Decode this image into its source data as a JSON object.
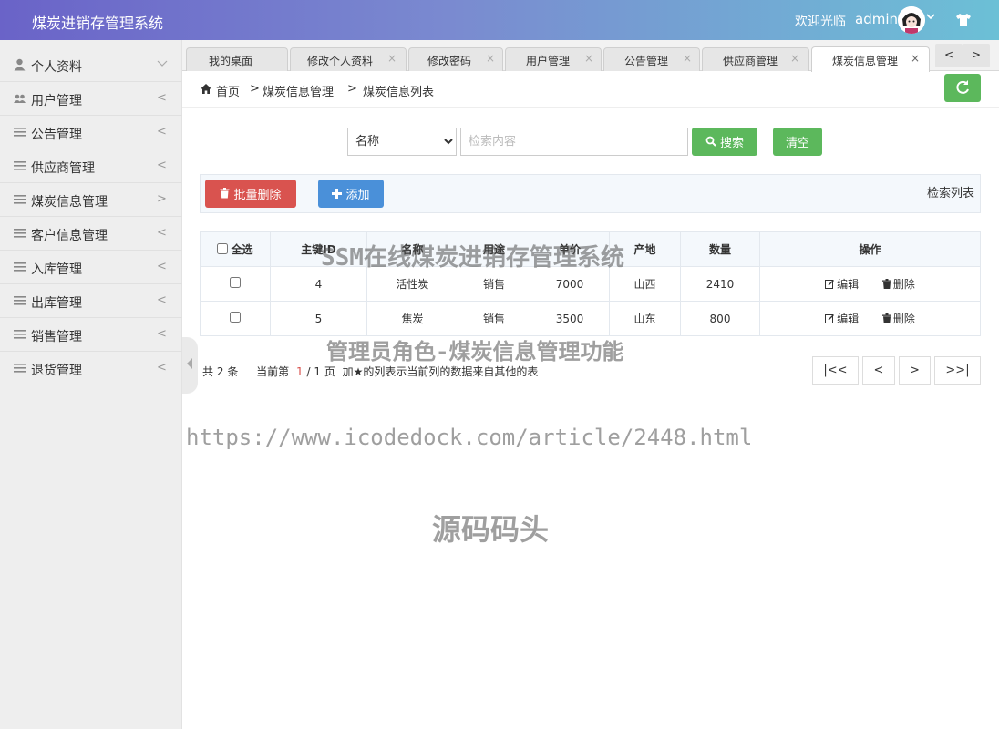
{
  "header": {
    "app_title": "煤炭进销存管理系统",
    "welcome": "欢迎光临",
    "username": "admin"
  },
  "sidebar": {
    "items": [
      {
        "label": "个人资料",
        "icon": "user-icon",
        "chevron": "﹀"
      },
      {
        "label": "用户管理",
        "icon": "users-icon",
        "chevron": "<"
      },
      {
        "label": "公告管理",
        "icon": "list-icon",
        "chevron": "<"
      },
      {
        "label": "供应商管理",
        "icon": "list-icon",
        "chevron": "<"
      },
      {
        "label": "煤炭信息管理",
        "icon": "list-icon",
        "chevron": ">"
      },
      {
        "label": "客户信息管理",
        "icon": "list-icon",
        "chevron": "<"
      },
      {
        "label": "入库管理",
        "icon": "list-icon",
        "chevron": "<"
      },
      {
        "label": "出库管理",
        "icon": "list-icon",
        "chevron": "<"
      },
      {
        "label": "销售管理",
        "icon": "list-icon",
        "chevron": "<"
      },
      {
        "label": "退货管理",
        "icon": "list-icon",
        "chevron": "<"
      }
    ]
  },
  "tabs": [
    {
      "label": "我的桌面",
      "closable": false,
      "active": false
    },
    {
      "label": "修改个人资料",
      "closable": true,
      "active": false
    },
    {
      "label": "修改密码",
      "closable": true,
      "active": false
    },
    {
      "label": "用户管理",
      "closable": true,
      "active": false
    },
    {
      "label": "公告管理",
      "closable": true,
      "active": false
    },
    {
      "label": "供应商管理",
      "closable": true,
      "active": false
    },
    {
      "label": "煤炭信息管理",
      "closable": true,
      "active": true
    }
  ],
  "tab_nav": {
    "prev": "<",
    "next": ">"
  },
  "breadcrumb": {
    "home": "首页",
    "level1": "煤炭信息管理",
    "level2": "煤炭信息列表",
    "sep": ">"
  },
  "search": {
    "field_selected": "名称",
    "placeholder": "检索内容",
    "search_label": "搜索",
    "clear_label": "清空"
  },
  "toolbar": {
    "batch_delete_label": "批量删除",
    "add_label": "添加",
    "right_label": "检索列表"
  },
  "table": {
    "select_all_label": "全选",
    "columns": [
      "主键ID",
      "名称",
      "用途",
      "单价",
      "产地",
      "数量",
      "操作"
    ],
    "rows": [
      {
        "id": "4",
        "name": "活性炭",
        "use": "销售",
        "price": "7000",
        "origin": "山西",
        "qty": "2410"
      },
      {
        "id": "5",
        "name": "焦炭",
        "use": "销售",
        "price": "3500",
        "origin": "山东",
        "qty": "800"
      }
    ],
    "edit_label": "编辑",
    "delete_label": "删除"
  },
  "pager": {
    "total_prefix": "共",
    "total": "2",
    "total_suffix": "条",
    "current_prefix": "当前第",
    "current": "1",
    "sep": "/",
    "pages": "1",
    "pages_suffix": "页",
    "note": "加★的列表示当前列的数据来自其他的表",
    "first": "|<<",
    "prev": "<",
    "next": ">",
    "last": ">>|"
  },
  "watermarks": {
    "w1": "SSM在线煤炭进销存管理系统",
    "w2": "管理员角色-煤炭信息管理功能",
    "w3": "https://www.icodedock.com/article/2448.html",
    "w4": "源码码头"
  },
  "colors": {
    "header_gradient_start": "#6a63c8",
    "header_gradient_end": "#6cc0d6",
    "success": "#5cb85c",
    "danger": "#d9534f",
    "primary": "#4a90d9"
  }
}
